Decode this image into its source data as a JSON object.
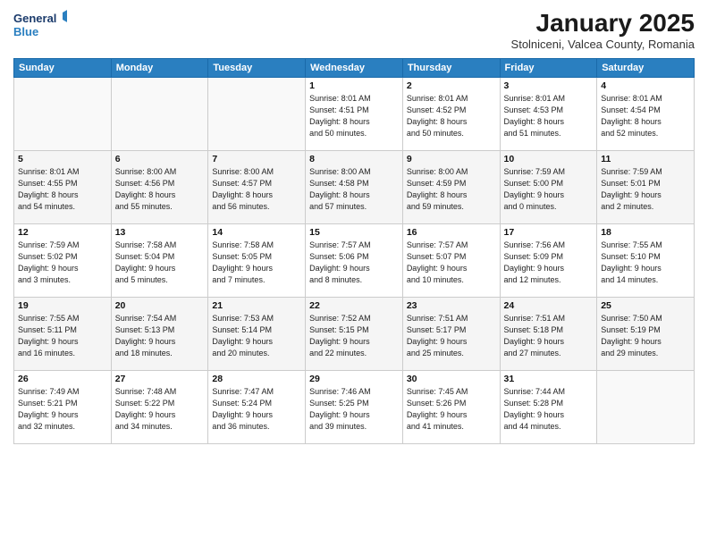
{
  "logo": {
    "line1": "General",
    "line2": "Blue"
  },
  "title": "January 2025",
  "subtitle": "Stolniceni, Valcea County, Romania",
  "weekdays": [
    "Sunday",
    "Monday",
    "Tuesday",
    "Wednesday",
    "Thursday",
    "Friday",
    "Saturday"
  ],
  "weeks": [
    [
      {
        "day": "",
        "info": ""
      },
      {
        "day": "",
        "info": ""
      },
      {
        "day": "",
        "info": ""
      },
      {
        "day": "1",
        "info": "Sunrise: 8:01 AM\nSunset: 4:51 PM\nDaylight: 8 hours\nand 50 minutes."
      },
      {
        "day": "2",
        "info": "Sunrise: 8:01 AM\nSunset: 4:52 PM\nDaylight: 8 hours\nand 50 minutes."
      },
      {
        "day": "3",
        "info": "Sunrise: 8:01 AM\nSunset: 4:53 PM\nDaylight: 8 hours\nand 51 minutes."
      },
      {
        "day": "4",
        "info": "Sunrise: 8:01 AM\nSunset: 4:54 PM\nDaylight: 8 hours\nand 52 minutes."
      }
    ],
    [
      {
        "day": "5",
        "info": "Sunrise: 8:01 AM\nSunset: 4:55 PM\nDaylight: 8 hours\nand 54 minutes."
      },
      {
        "day": "6",
        "info": "Sunrise: 8:00 AM\nSunset: 4:56 PM\nDaylight: 8 hours\nand 55 minutes."
      },
      {
        "day": "7",
        "info": "Sunrise: 8:00 AM\nSunset: 4:57 PM\nDaylight: 8 hours\nand 56 minutes."
      },
      {
        "day": "8",
        "info": "Sunrise: 8:00 AM\nSunset: 4:58 PM\nDaylight: 8 hours\nand 57 minutes."
      },
      {
        "day": "9",
        "info": "Sunrise: 8:00 AM\nSunset: 4:59 PM\nDaylight: 8 hours\nand 59 minutes."
      },
      {
        "day": "10",
        "info": "Sunrise: 7:59 AM\nSunset: 5:00 PM\nDaylight: 9 hours\nand 0 minutes."
      },
      {
        "day": "11",
        "info": "Sunrise: 7:59 AM\nSunset: 5:01 PM\nDaylight: 9 hours\nand 2 minutes."
      }
    ],
    [
      {
        "day": "12",
        "info": "Sunrise: 7:59 AM\nSunset: 5:02 PM\nDaylight: 9 hours\nand 3 minutes."
      },
      {
        "day": "13",
        "info": "Sunrise: 7:58 AM\nSunset: 5:04 PM\nDaylight: 9 hours\nand 5 minutes."
      },
      {
        "day": "14",
        "info": "Sunrise: 7:58 AM\nSunset: 5:05 PM\nDaylight: 9 hours\nand 7 minutes."
      },
      {
        "day": "15",
        "info": "Sunrise: 7:57 AM\nSunset: 5:06 PM\nDaylight: 9 hours\nand 8 minutes."
      },
      {
        "day": "16",
        "info": "Sunrise: 7:57 AM\nSunset: 5:07 PM\nDaylight: 9 hours\nand 10 minutes."
      },
      {
        "day": "17",
        "info": "Sunrise: 7:56 AM\nSunset: 5:09 PM\nDaylight: 9 hours\nand 12 minutes."
      },
      {
        "day": "18",
        "info": "Sunrise: 7:55 AM\nSunset: 5:10 PM\nDaylight: 9 hours\nand 14 minutes."
      }
    ],
    [
      {
        "day": "19",
        "info": "Sunrise: 7:55 AM\nSunset: 5:11 PM\nDaylight: 9 hours\nand 16 minutes."
      },
      {
        "day": "20",
        "info": "Sunrise: 7:54 AM\nSunset: 5:13 PM\nDaylight: 9 hours\nand 18 minutes."
      },
      {
        "day": "21",
        "info": "Sunrise: 7:53 AM\nSunset: 5:14 PM\nDaylight: 9 hours\nand 20 minutes."
      },
      {
        "day": "22",
        "info": "Sunrise: 7:52 AM\nSunset: 5:15 PM\nDaylight: 9 hours\nand 22 minutes."
      },
      {
        "day": "23",
        "info": "Sunrise: 7:51 AM\nSunset: 5:17 PM\nDaylight: 9 hours\nand 25 minutes."
      },
      {
        "day": "24",
        "info": "Sunrise: 7:51 AM\nSunset: 5:18 PM\nDaylight: 9 hours\nand 27 minutes."
      },
      {
        "day": "25",
        "info": "Sunrise: 7:50 AM\nSunset: 5:19 PM\nDaylight: 9 hours\nand 29 minutes."
      }
    ],
    [
      {
        "day": "26",
        "info": "Sunrise: 7:49 AM\nSunset: 5:21 PM\nDaylight: 9 hours\nand 32 minutes."
      },
      {
        "day": "27",
        "info": "Sunrise: 7:48 AM\nSunset: 5:22 PM\nDaylight: 9 hours\nand 34 minutes."
      },
      {
        "day": "28",
        "info": "Sunrise: 7:47 AM\nSunset: 5:24 PM\nDaylight: 9 hours\nand 36 minutes."
      },
      {
        "day": "29",
        "info": "Sunrise: 7:46 AM\nSunset: 5:25 PM\nDaylight: 9 hours\nand 39 minutes."
      },
      {
        "day": "30",
        "info": "Sunrise: 7:45 AM\nSunset: 5:26 PM\nDaylight: 9 hours\nand 41 minutes."
      },
      {
        "day": "31",
        "info": "Sunrise: 7:44 AM\nSunset: 5:28 PM\nDaylight: 9 hours\nand 44 minutes."
      },
      {
        "day": "",
        "info": ""
      }
    ]
  ]
}
